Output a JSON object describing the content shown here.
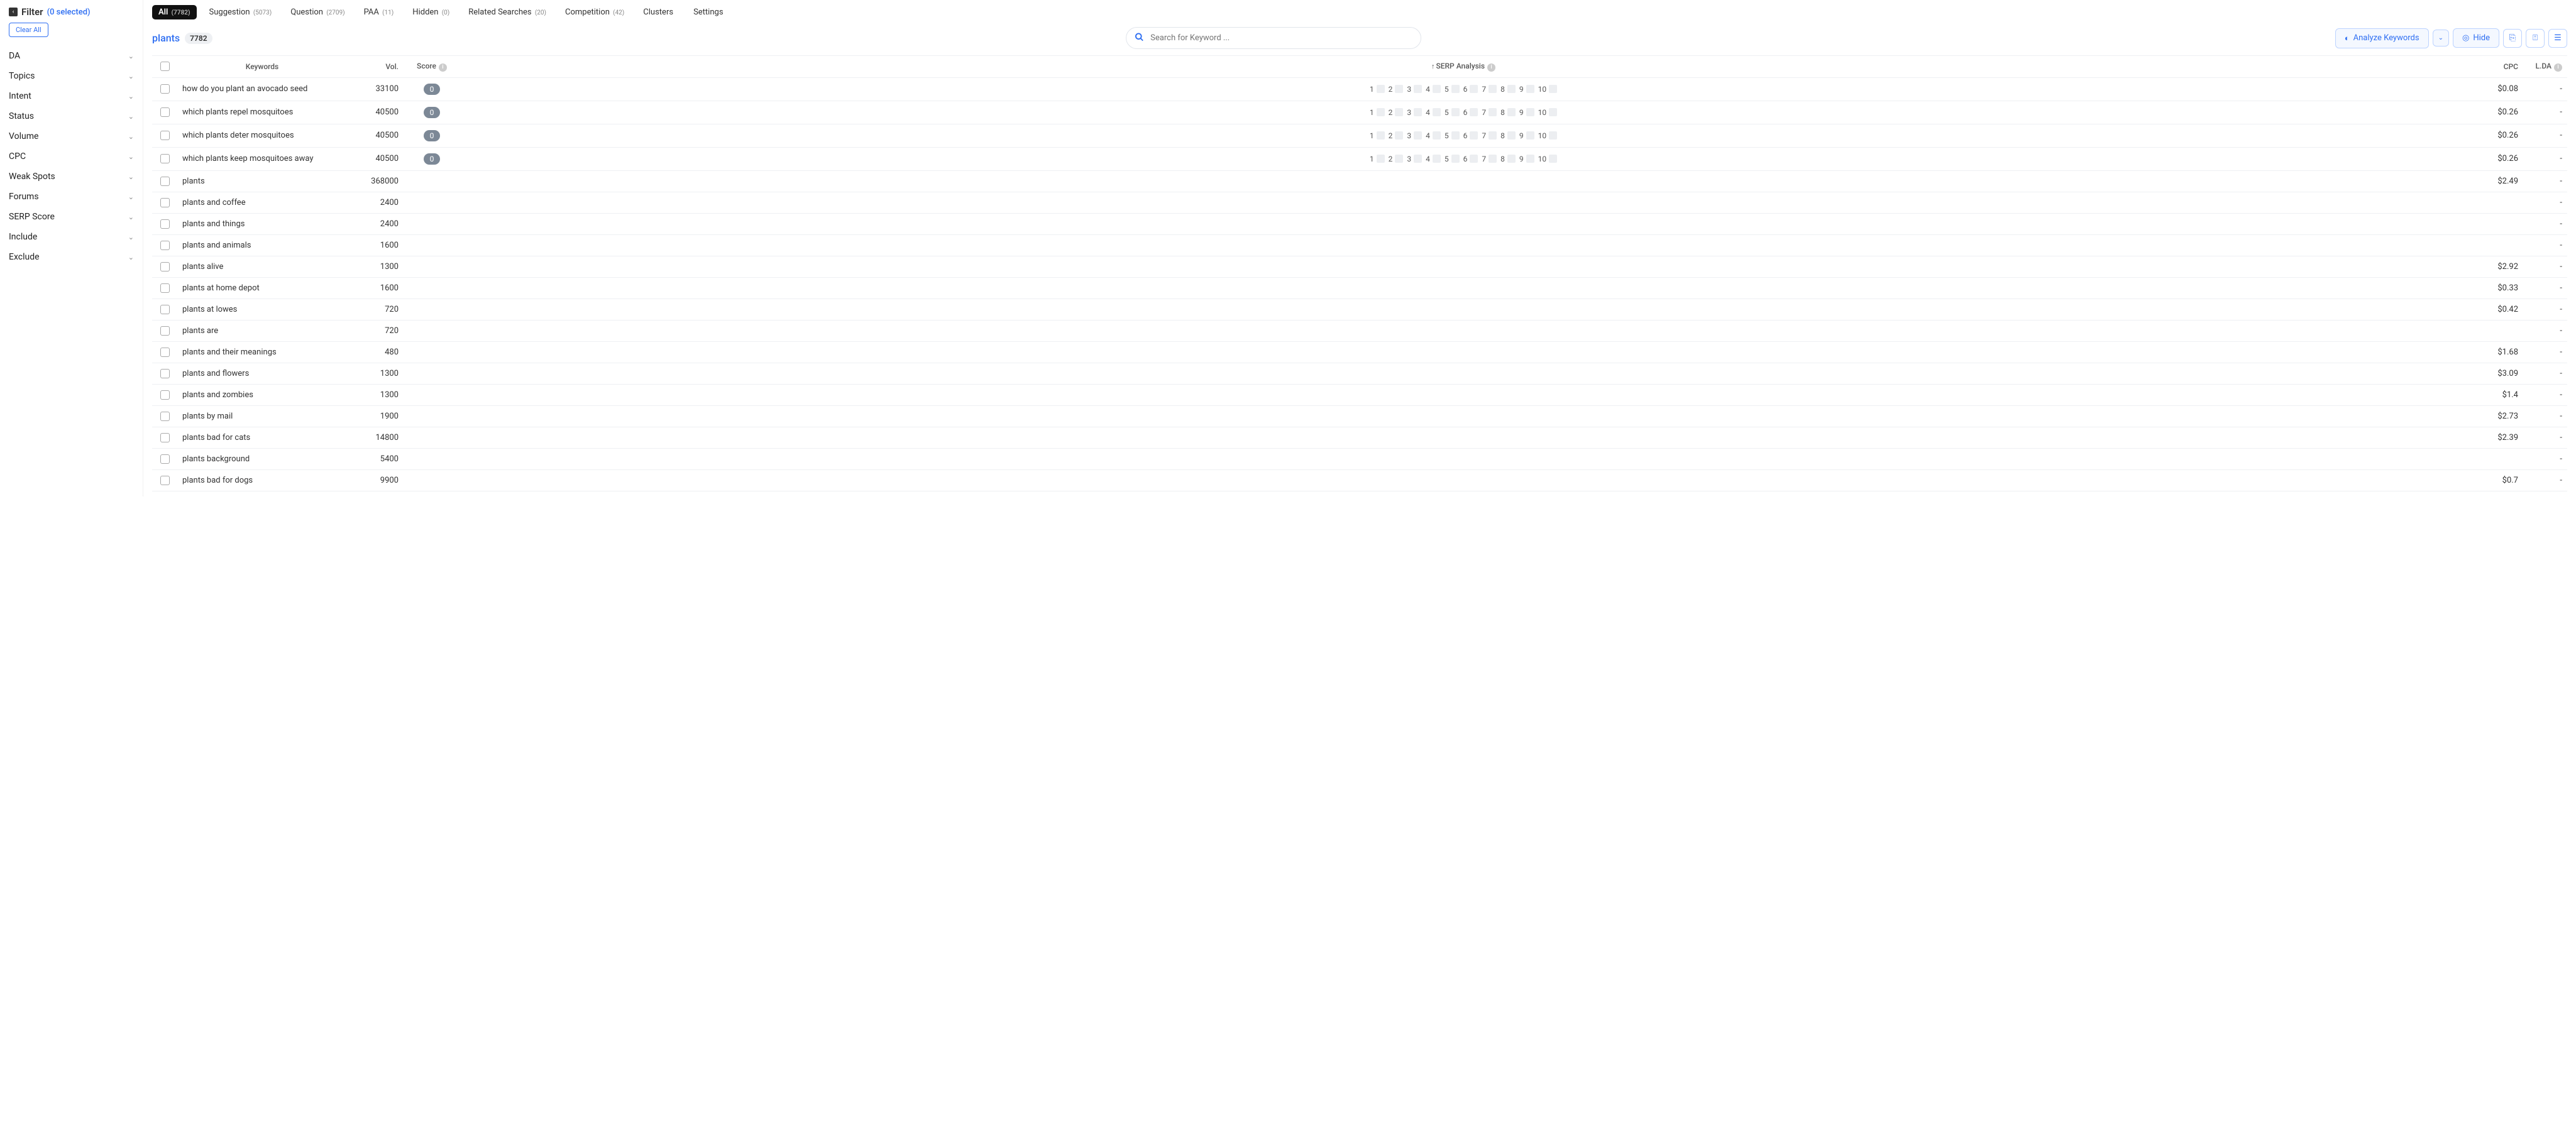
{
  "filter": {
    "title": "Filter",
    "selected_text": "(0 selected)",
    "clear_label": "Clear All",
    "items": [
      "DA",
      "Topics",
      "Intent",
      "Status",
      "Volume",
      "CPC",
      "Weak Spots",
      "Forums",
      "SERP Score",
      "Include",
      "Exclude"
    ]
  },
  "tabs": [
    {
      "label": "All",
      "count": "(7782)",
      "active": true
    },
    {
      "label": "Suggestion",
      "count": "(5073)"
    },
    {
      "label": "Question",
      "count": "(2709)"
    },
    {
      "label": "PAA",
      "count": "(11)"
    },
    {
      "label": "Hidden",
      "count": "(0)"
    },
    {
      "label": "Related Searches",
      "count": "(20)"
    },
    {
      "label": "Competition",
      "count": "(42)"
    },
    {
      "label": "Clusters",
      "count": ""
    },
    {
      "label": "Settings",
      "count": ""
    }
  ],
  "header": {
    "keyword": "plants",
    "count": "7782",
    "search_placeholder": "Search for Keyword ...",
    "analyze_label": "Analyze Keywords",
    "hide_label": "Hide"
  },
  "columns": {
    "keywords": "Keywords",
    "vol": "Vol.",
    "score": "Score",
    "serp": "SERP Analysis",
    "cpc": "CPC",
    "lda": "L.DA"
  },
  "serp_nums": [
    "1",
    "2",
    "3",
    "4",
    "5",
    "6",
    "7",
    "8",
    "9",
    "10"
  ],
  "rows": [
    {
      "kw": "how do you plant an avocado seed",
      "vol": "33100",
      "score": "0",
      "serp": true,
      "cpc": "$0.08",
      "lda": "-"
    },
    {
      "kw": "which plants repel mosquitoes",
      "vol": "40500",
      "score": "0",
      "serp": true,
      "cpc": "$0.26",
      "lda": "-"
    },
    {
      "kw": "which plants deter mosquitoes",
      "vol": "40500",
      "score": "0",
      "serp": true,
      "cpc": "$0.26",
      "lda": "-"
    },
    {
      "kw": "which plants keep mosquitoes away",
      "vol": "40500",
      "score": "0",
      "serp": true,
      "cpc": "$0.26",
      "lda": "-"
    },
    {
      "kw": "plants",
      "vol": "368000",
      "score": "",
      "serp": false,
      "cpc": "$2.49",
      "lda": "-"
    },
    {
      "kw": "plants and coffee",
      "vol": "2400",
      "score": "",
      "serp": false,
      "cpc": "",
      "lda": "-"
    },
    {
      "kw": "plants and things",
      "vol": "2400",
      "score": "",
      "serp": false,
      "cpc": "",
      "lda": "-"
    },
    {
      "kw": "plants and animals",
      "vol": "1600",
      "score": "",
      "serp": false,
      "cpc": "",
      "lda": "-"
    },
    {
      "kw": "plants alive",
      "vol": "1300",
      "score": "",
      "serp": false,
      "cpc": "$2.92",
      "lda": "-"
    },
    {
      "kw": "plants at home depot",
      "vol": "1600",
      "score": "",
      "serp": false,
      "cpc": "$0.33",
      "lda": "-"
    },
    {
      "kw": "plants at lowes",
      "vol": "720",
      "score": "",
      "serp": false,
      "cpc": "$0.42",
      "lda": "-"
    },
    {
      "kw": "plants are",
      "vol": "720",
      "score": "",
      "serp": false,
      "cpc": "",
      "lda": "-"
    },
    {
      "kw": "plants and their meanings",
      "vol": "480",
      "score": "",
      "serp": false,
      "cpc": "$1.68",
      "lda": "-"
    },
    {
      "kw": "plants and flowers",
      "vol": "1300",
      "score": "",
      "serp": false,
      "cpc": "$3.09",
      "lda": "-"
    },
    {
      "kw": "plants and zombies",
      "vol": "1300",
      "score": "",
      "serp": false,
      "cpc": "$1.4",
      "lda": "-"
    },
    {
      "kw": "plants by mail",
      "vol": "1900",
      "score": "",
      "serp": false,
      "cpc": "$2.73",
      "lda": "-"
    },
    {
      "kw": "plants bad for cats",
      "vol": "14800",
      "score": "",
      "serp": false,
      "cpc": "$2.39",
      "lda": "-"
    },
    {
      "kw": "plants background",
      "vol": "5400",
      "score": "",
      "serp": false,
      "cpc": "",
      "lda": "-"
    },
    {
      "kw": "plants bad for dogs",
      "vol": "9900",
      "score": "",
      "serp": false,
      "cpc": "$0.7",
      "lda": "-"
    }
  ]
}
